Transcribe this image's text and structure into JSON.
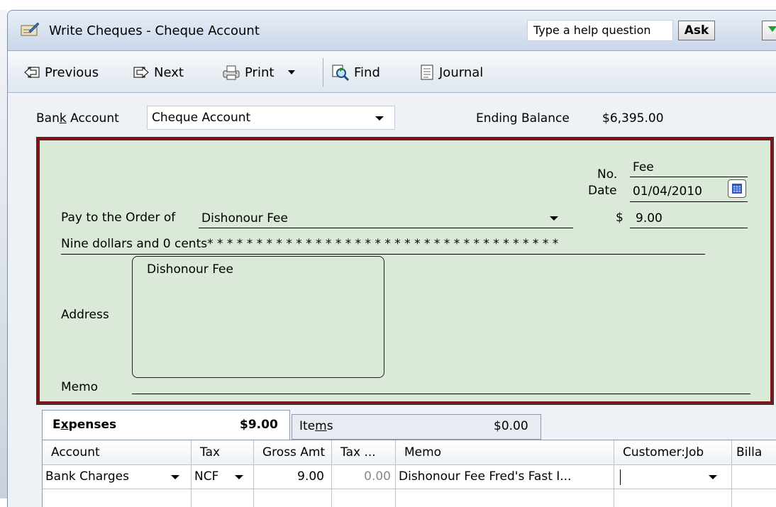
{
  "window": {
    "title": "Write Cheques - Cheque Account",
    "help_placeholder": "Type a help question",
    "ask_label": "Ask"
  },
  "toolbar": {
    "previous": "Previous",
    "next": "Next",
    "print": "Print",
    "find": "Find",
    "journal": "Journal"
  },
  "account": {
    "bank_label_pre": "Ban",
    "bank_label_accel": "k",
    "bank_label_post": " Account",
    "bank_value": "Cheque Account",
    "ending_label": "Ending Balance",
    "ending_value": "$6,395.00"
  },
  "cheque": {
    "no_label": "No.",
    "no_value": "Fee",
    "date_label": "Date",
    "date_value": "01/04/2010",
    "pay_label": "Pay to the Order of",
    "payee": "Dishonour Fee",
    "amount_label": "$",
    "amount": "9.00",
    "amount_words": "Nine dollars and 0 cents",
    "amount_fill": "* * * * * * * * * * * * * * * * * * * * * * * * * * * * * * * * * * * *",
    "address_label": "Address",
    "address_text": "Dishonour Fee",
    "memo_label": "Memo"
  },
  "tabs": {
    "expenses_pre": "E",
    "expenses_accel": "x",
    "expenses_post": "penses",
    "expenses_total": "$9.00",
    "items_pre": "Ite",
    "items_accel": "m",
    "items_post": "s",
    "items_total": "$0.00"
  },
  "grid": {
    "headers": [
      "Account",
      "Tax",
      "Gross Amt",
      "Tax ...",
      "Memo",
      "Customer:Job",
      "Billa"
    ],
    "row": {
      "account": "Bank Charges",
      "tax": "NCF",
      "gross": "9.00",
      "tax_amt": "0.00",
      "memo": "Dishonour Fee Fred's Fast I...",
      "customer": ""
    }
  },
  "colors": {
    "cheque_bg": "#dbead8",
    "cheque_border": "#7a1518"
  }
}
